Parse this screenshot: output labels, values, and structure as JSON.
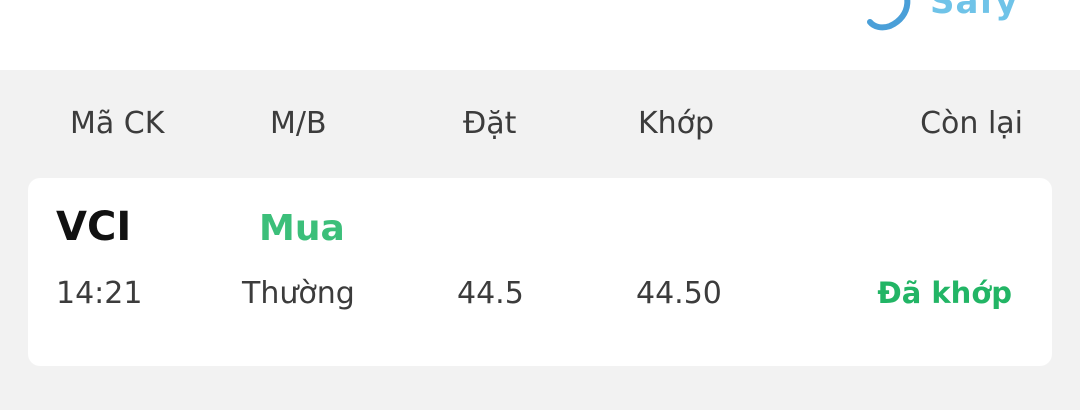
{
  "brand": {
    "name": "Safy",
    "color": "#6fc3e8"
  },
  "order_table": {
    "headers": {
      "code": "Mã CK",
      "side": "M/B",
      "order_price": "Đặt",
      "matched_price": "Khớp",
      "remaining": "Còn lại"
    },
    "rows": [
      {
        "ticker": "VCI",
        "side": "Mua",
        "time": "14:21",
        "order_type": "Thường",
        "order_price": "44.5",
        "matched_price": "44.50",
        "status": "Đã khớp"
      }
    ]
  },
  "colors": {
    "buy": "#3cbf7a",
    "status_matched": "#22b565",
    "background": "#f2f2f2"
  }
}
